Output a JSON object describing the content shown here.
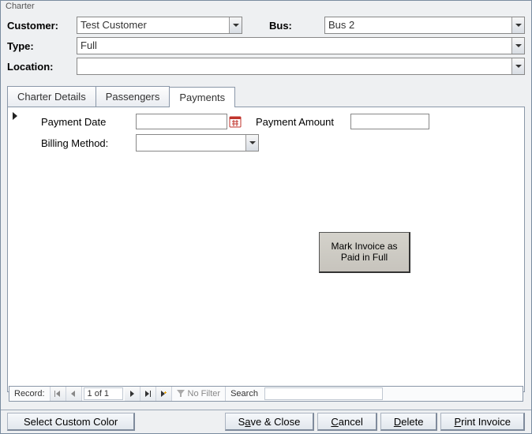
{
  "window": {
    "title": "Charter"
  },
  "header": {
    "customer_label": "Customer:",
    "customer_value": "Test Customer",
    "bus_label": "Bus:",
    "bus_value": "Bus 2",
    "type_label": "Type:",
    "type_value": "Full",
    "location_label": "Location:",
    "location_value": ""
  },
  "tabs": [
    {
      "label": "Charter Details",
      "active": false
    },
    {
      "label": "Passengers",
      "active": false
    },
    {
      "label": "Payments",
      "active": true
    }
  ],
  "payments": {
    "payment_date_label": "Payment Date",
    "payment_date_value": "",
    "payment_amount_label": "Payment Amount",
    "payment_amount_value": "",
    "billing_method_label": "Billing Method:",
    "billing_method_value": "",
    "mark_paid_line1": "Mark Invoice as",
    "mark_paid_line2": "Paid in Full"
  },
  "record_nav": {
    "label": "Record:",
    "counter": "1 of 1",
    "filter_text": "No Filter",
    "search_label": "Search",
    "search_value": ""
  },
  "buttons": {
    "custom_color": "Select Custom Color",
    "save_close_pre": "S",
    "save_close_u": "a",
    "save_close_post": "ve & Close",
    "cancel_pre": "",
    "cancel_u": "C",
    "cancel_post": "ancel",
    "delete_pre": "",
    "delete_u": "D",
    "delete_post": "elete",
    "print_pre": "",
    "print_u": "P",
    "print_post": "rint Invoice"
  }
}
